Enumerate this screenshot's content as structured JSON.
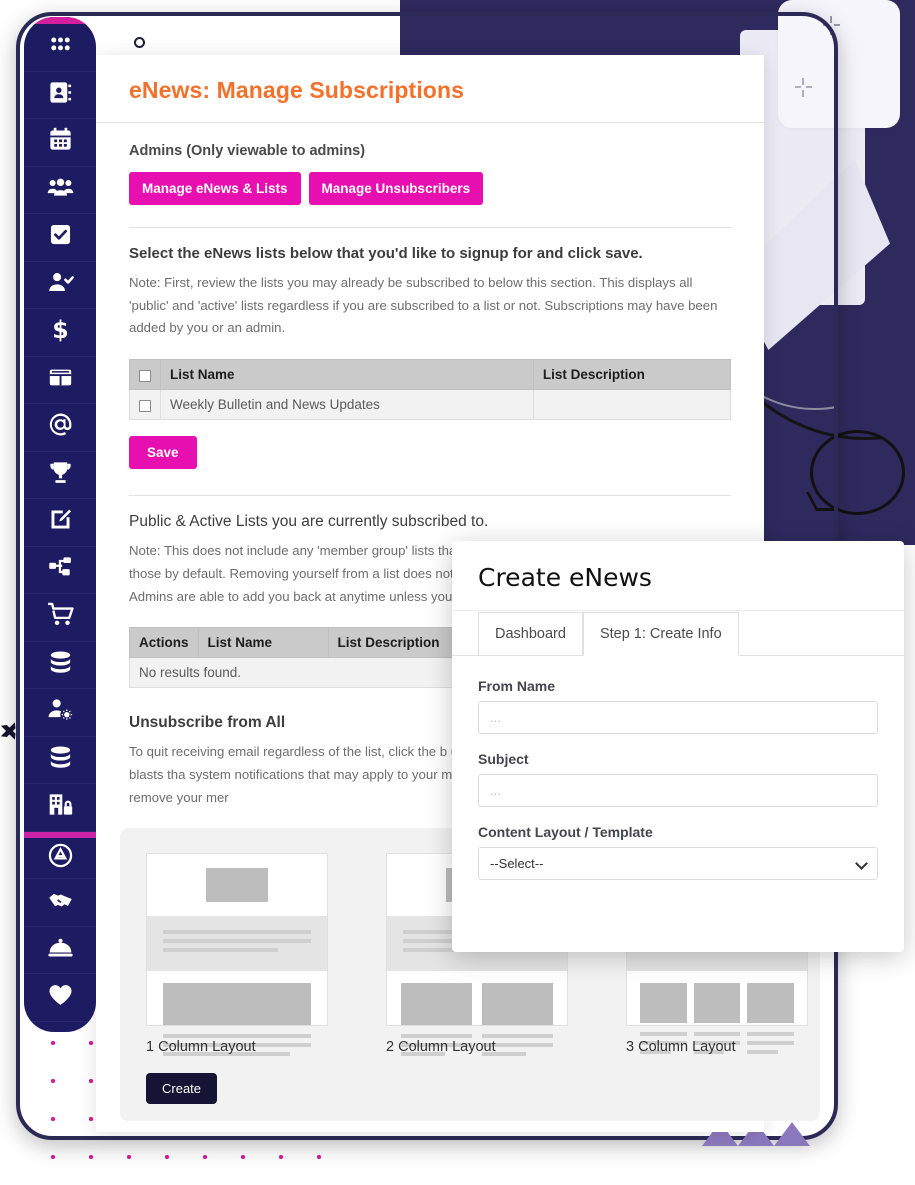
{
  "sidebar": {
    "items": [
      {
        "icon": "grid-apps-icon",
        "name": "dashboard"
      },
      {
        "icon": "address-book-icon",
        "name": "contacts"
      },
      {
        "icon": "calendar-icon",
        "name": "calendar"
      },
      {
        "icon": "people-group-icon",
        "name": "members"
      },
      {
        "icon": "checkbox-check-icon",
        "name": "tasks"
      },
      {
        "icon": "user-check-icon",
        "name": "attendance"
      },
      {
        "icon": "dollar-sign-icon",
        "name": "finance"
      },
      {
        "icon": "table-grid-icon",
        "name": "tables"
      },
      {
        "icon": "at-sign-icon",
        "name": "enews"
      },
      {
        "icon": "trophy-icon",
        "name": "awards"
      },
      {
        "icon": "edit-square-icon",
        "name": "forms"
      },
      {
        "icon": "share-nodes-icon",
        "name": "integrations"
      },
      {
        "icon": "shopping-cart-icon",
        "name": "store"
      },
      {
        "icon": "database-icon",
        "name": "data"
      },
      {
        "icon": "user-gear-icon",
        "name": "user-settings"
      },
      {
        "icon": "database-icon",
        "name": "records"
      },
      {
        "icon": "building-lock-icon",
        "name": "admin-security"
      },
      {
        "icon": "app-circle-icon",
        "name": "apps"
      },
      {
        "icon": "handshake-icon",
        "name": "partners"
      },
      {
        "icon": "service-bell-icon",
        "name": "support"
      },
      {
        "icon": "heart-icon",
        "name": "favorites"
      }
    ]
  },
  "main": {
    "title": "eNews: Manage Subscriptions",
    "admins_label": "Admins (Only viewable to admins)",
    "admin_buttons": [
      {
        "label": "Manage eNews & Lists"
      },
      {
        "label": "Manage Unsubscribers"
      }
    ],
    "section1": {
      "heading": "Select the eNews lists below that you'd like to signup for and click save.",
      "note": "Note: First, review the lists you may already be subscribed to below this section. This displays all 'public' and 'active' lists regardless if you are subscribed to a list or not. Subscriptions may have been added by you or an admin.",
      "table": {
        "headers": [
          "",
          "List Name",
          "List Description"
        ],
        "rows": [
          {
            "list_name": "Weekly Bulletin and News Updates",
            "list_description": ""
          }
        ]
      },
      "save_label": "Save"
    },
    "section2": {
      "heading": "Public & Active Lists you are currently subscribed to.",
      "note": "Note: This does not include any 'member group' lists that you are assigned to as you'll be included on those by default. Removing yourself from a list does not unsubscribe and 'stop' future emails to you. Admins are able to add you back at anytime unless you unsubscribe link in an email that you received.",
      "table": {
        "headers": [
          "Actions",
          "List Name",
          "List Description"
        ],
        "empty_text": "No results found."
      }
    },
    "section3": {
      "heading": "Unsubscribe from All",
      "note": "To quit receiving email regardless of the list, click the b unsubscribed. This will remove you from any blasts tha system notifications that may apply to your member p admin or account owner will need to remove your mer"
    }
  },
  "templates": {
    "items": [
      {
        "caption": "1 Column Layout",
        "columns": 1
      },
      {
        "caption": "2 Column Layout",
        "columns": 2
      },
      {
        "caption": "3 Column Layout",
        "columns": 3
      }
    ],
    "create_label": "Create"
  },
  "modal": {
    "title": "Create eNews",
    "tabs": [
      {
        "label": "Dashboard",
        "active": false
      },
      {
        "label": "Step 1: Create Info",
        "active": true
      }
    ],
    "fields": {
      "from_name_label": "From Name",
      "from_name_value": "",
      "from_name_placeholder": "...",
      "subject_label": "Subject",
      "subject_value": "",
      "subject_placeholder": "...",
      "template_label": "Content Layout / Template",
      "template_selected": "--Select--"
    }
  },
  "colors": {
    "accent_orange": "#f4712c",
    "accent_pink": "#e80fb0",
    "sidebar_navy": "#1d1b62",
    "dark_navy": "#2b2a57",
    "decor_yellow": "#fbe05a",
    "decor_purple": "#8a79bd",
    "dot_magenta": "#d61fa0"
  }
}
